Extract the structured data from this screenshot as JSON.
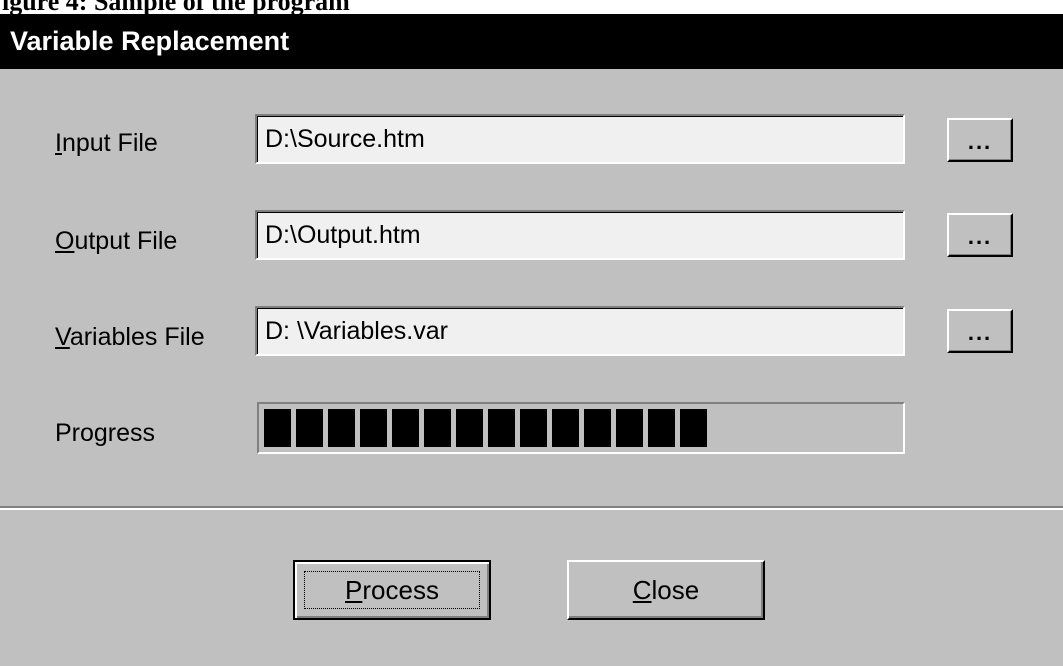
{
  "doc_caption": "igure 4: Sample of the program",
  "window": {
    "title": "Variable Replacement"
  },
  "form": {
    "input_file": {
      "label_mnemonic": "I",
      "label_rest": "nput File",
      "value": "D:\\Source.htm",
      "browse_label": "..."
    },
    "output_file": {
      "label_mnemonic": "O",
      "label_rest": "utput File",
      "value": "D:\\Output.htm",
      "browse_label": "..."
    },
    "variables_file": {
      "label_mnemonic": "V",
      "label_rest": "ariables File",
      "value": "D: \\Variables.var",
      "browse_label": "..."
    },
    "progress": {
      "label": "Progress",
      "filled_blocks": 14,
      "fraction": 0.7
    }
  },
  "buttons": {
    "process": {
      "mnemonic": "P",
      "rest": "rocess"
    },
    "close": {
      "mnemonic": "C",
      "rest": "lose"
    }
  },
  "colors": {
    "dialog_face": "#c0c0c0",
    "titlebar": "#000000",
    "field_bg": "#f0f0f0",
    "progress_block": "#000000"
  }
}
